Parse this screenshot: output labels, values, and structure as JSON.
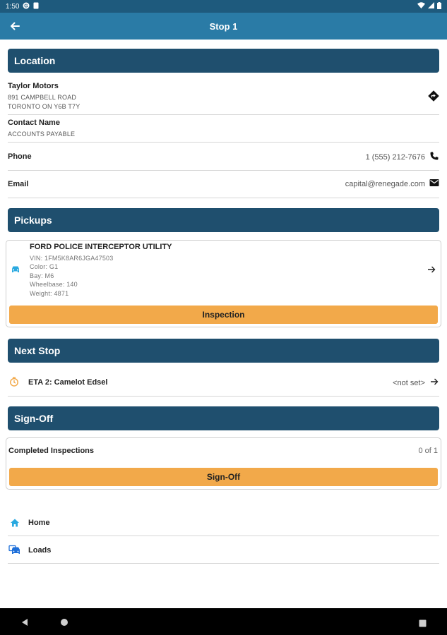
{
  "status": {
    "time": "1:50"
  },
  "appbar": {
    "title": "Stop 1"
  },
  "location": {
    "header": "Location",
    "company": "Taylor Motors",
    "address1": "891 CAMPBELL ROAD",
    "address2": "TORONTO ON Y6B T7Y",
    "contact_label": "Contact Name",
    "contact_value": "ACCOUNTS PAYABLE",
    "phone_label": "Phone",
    "phone_value": "1 (555) 212-7676",
    "email_label": "Email",
    "email_value": "capital@renegade.com"
  },
  "pickups": {
    "header": "Pickups",
    "vehicle_title": "FORD POLICE INTERCEPTOR UTILITY",
    "details": [
      "VIN: 1FM5K8AR6JGA47503",
      "Color: G1",
      "Bay: M6",
      "Wheelbase: 140",
      "Weight: 4871"
    ],
    "inspection_button": "Inspection"
  },
  "next_stop": {
    "header": "Next Stop",
    "label": "ETA 2: Camelot Edsel",
    "value": "<not set>"
  },
  "signoff": {
    "header": "Sign-Off",
    "completed_label": "Completed Inspections",
    "completed_value": "0 of 1",
    "button": "Sign-Off"
  },
  "nav": [
    {
      "label": "Home",
      "icon": "home-icon"
    },
    {
      "label": "Loads",
      "icon": "truck-icon"
    }
  ],
  "colors": {
    "appbar": "#2a7ba6",
    "section_header": "#1f4f6e",
    "button": "#f2a94a",
    "accent_icon": "#29a9e0"
  }
}
